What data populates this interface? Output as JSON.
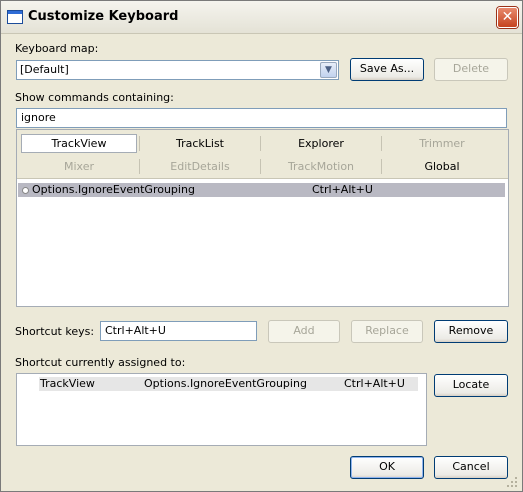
{
  "window": {
    "title": "Customize Keyboard"
  },
  "keyboard_map": {
    "label": "Keyboard map:",
    "value": "[Default]",
    "save_as": "Save As...",
    "delete": "Delete"
  },
  "filter": {
    "label": "Show commands containing:",
    "value": "ignore"
  },
  "tabs": [
    {
      "label": "TrackView",
      "state": "selected"
    },
    {
      "label": "TrackList",
      "state": "normal"
    },
    {
      "label": "Explorer",
      "state": "normal"
    },
    {
      "label": "Trimmer",
      "state": "disabled"
    },
    {
      "label": "Mixer",
      "state": "disabled"
    },
    {
      "label": "EditDetails",
      "state": "disabled"
    },
    {
      "label": "TrackMotion",
      "state": "disabled"
    },
    {
      "label": "Global",
      "state": "normal"
    }
  ],
  "commands": [
    {
      "name": "Options.IgnoreEventGrouping",
      "shortcut": "Ctrl+Alt+U"
    }
  ],
  "shortcut": {
    "label": "Shortcut keys:",
    "value": "Ctrl+Alt+U",
    "add": "Add",
    "replace": "Replace",
    "remove": "Remove"
  },
  "assigned": {
    "label": "Shortcut currently assigned to:",
    "rows": [
      {
        "context": "TrackView",
        "command": "Options.IgnoreEventGrouping",
        "keys": "Ctrl+Alt+U"
      }
    ],
    "locate": "Locate"
  },
  "footer": {
    "ok": "OK",
    "cancel": "Cancel"
  },
  "icons": {
    "close": "close-icon",
    "window": "window-icon",
    "dropdown": "chevron-down-icon",
    "resize": "resize-grip-icon"
  },
  "colors": {
    "selection": "#b9b9c3",
    "dialog_bg": "#ece9d8",
    "close_button": "#c5431f"
  }
}
